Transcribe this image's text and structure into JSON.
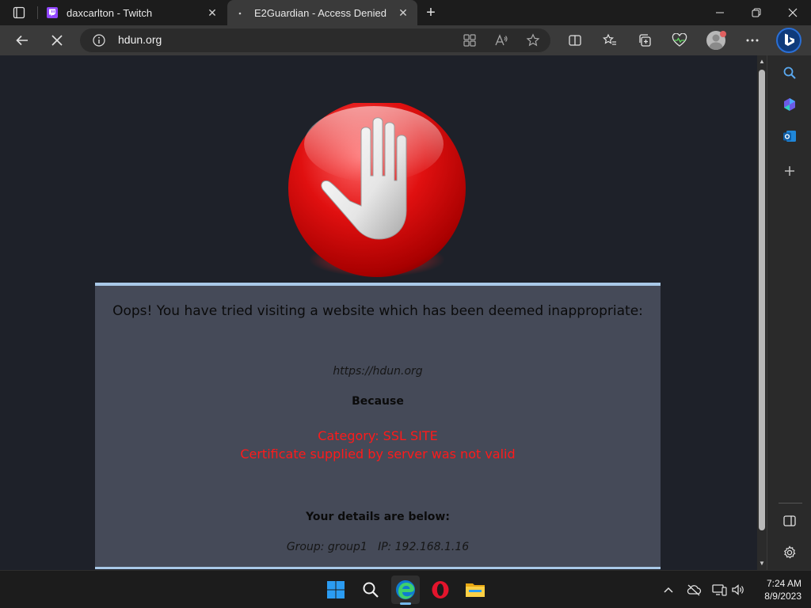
{
  "browser": {
    "tabs": [
      {
        "title": "daxcarlton - Twitch",
        "active": false,
        "favicon": "twitch-icon"
      },
      {
        "title": "E2Guardian - Access Denied",
        "active": true,
        "favicon": "loading-icon"
      }
    ],
    "address": {
      "url": "hdun.org"
    },
    "accent_color": "#2a6fd6"
  },
  "page": {
    "heading": "Oops! You have tried visiting a website which has been deemed inappropriate:",
    "blocked_url": "https://hdun.org",
    "because_label": "Because",
    "reason_category": "Category: SSL SITE",
    "reason_detail": "Certificate supplied by server was not valid",
    "details_label": "Your details are below:",
    "group_info": "Group: group1   IP: 192.168.1.16",
    "reason_color": "#ff1a1a",
    "panel_color": "#454a58",
    "panel_border_color": "#a9c9e8"
  },
  "taskbar": {
    "apps": [
      "start-icon",
      "search-icon",
      "edge-icon",
      "opera-icon",
      "file-explorer-icon"
    ],
    "clock": {
      "time": "7:24 AM",
      "date": "8/9/2023"
    }
  }
}
